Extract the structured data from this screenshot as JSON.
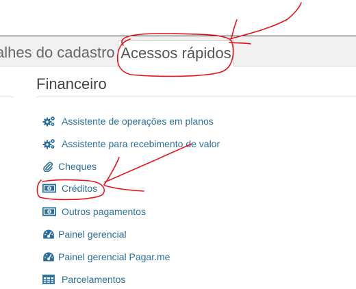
{
  "tabs": {
    "details_label": "alhes do cadastro",
    "quick_label": "Acessos rápidos"
  },
  "section": {
    "title": "Financeiro"
  },
  "items": [
    {
      "label": "Assistente de operações em planos",
      "icon": "gears-icon"
    },
    {
      "label": "Assistente para recebimento de valor",
      "icon": "gears-icon"
    },
    {
      "label": "Cheques",
      "icon": "paperclip-icon"
    },
    {
      "label": "Créditos",
      "icon": "money-icon"
    },
    {
      "label": "Outros pagamentos",
      "icon": "money-icon"
    },
    {
      "label": "Painel gerencial",
      "icon": "dashboard-icon"
    },
    {
      "label": "Painel gerencial Pagar.me",
      "icon": "dashboard-icon"
    },
    {
      "label": "Parcelamentos",
      "icon": "table-icon"
    }
  ],
  "colors": {
    "link": "#2a6f9c",
    "annotation": "#e8141c"
  }
}
